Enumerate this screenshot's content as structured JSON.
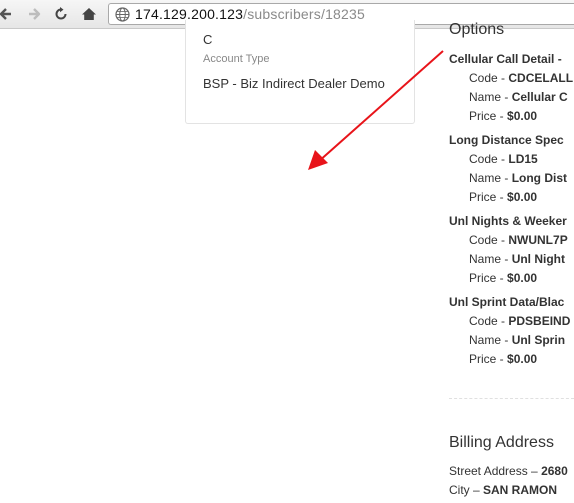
{
  "browser": {
    "url_host": "174.129.200.123",
    "url_path": "/subscribers/18235"
  },
  "account": {
    "value_top": "C",
    "account_type_label": "Account Type",
    "account_type_value": "BSP - Biz Indirect Dealer Demo"
  },
  "options": {
    "title": "Options",
    "code_label": "Code - ",
    "name_label": "Name - ",
    "price_label": "Price - ",
    "items": [
      {
        "name": "Cellular Call Detail -",
        "code": "CDCELALL",
        "name_value": "Cellular C",
        "price": "$0.00"
      },
      {
        "name": "Long Distance Spec",
        "code": "LD15",
        "name_value": "Long Dist",
        "price": "$0.00"
      },
      {
        "name": "Unl Nights & Weeker",
        "code": "NWUNL7P",
        "name_value": "Unl Night",
        "price": "$0.00"
      },
      {
        "name": "Unl Sprint Data/Blac",
        "code": "PDSBEIND",
        "name_value": "Unl Sprin",
        "price": "$0.00"
      }
    ]
  },
  "billing": {
    "title": "Billing Address",
    "street_label": "Street Address – ",
    "street_value": "2680",
    "city_label": "City – ",
    "city_value": "SAN RAMON"
  },
  "annotation": {
    "arrow_color": "#e8141a"
  }
}
